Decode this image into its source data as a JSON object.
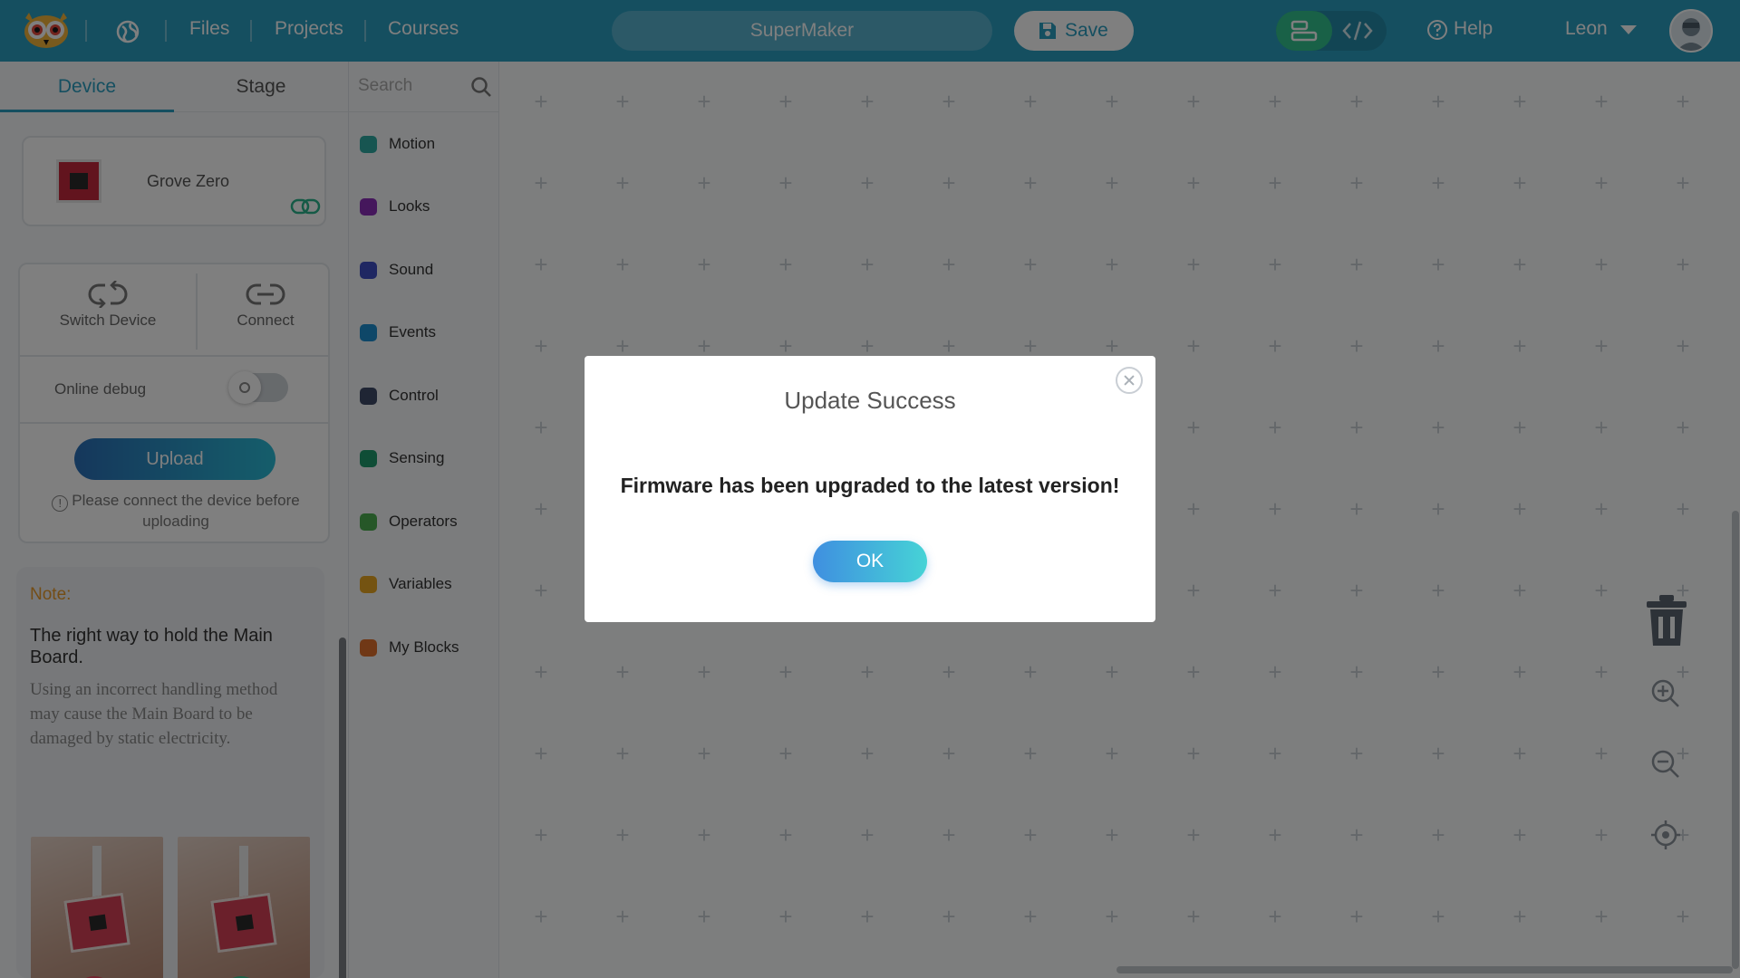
{
  "colors": {
    "topbar": "#2a9ec1",
    "accent": "#2a9ec1",
    "note_title": "#e89a2a",
    "ok_start": "#3f8fe0",
    "ok_end": "#46d3d6"
  },
  "topbar": {
    "logo_icon": "owl-logo-icon",
    "language_icon": "globe-icon",
    "menu": [
      "Files",
      "Projects",
      "Courses"
    ],
    "project_name": "SuperMaker",
    "save_label": "Save",
    "help_label": "Help",
    "user_name": "Leon"
  },
  "left_panel": {
    "tabs": [
      "Device",
      "Stage"
    ],
    "active_tab": "Device",
    "device_name": "Grove Zero",
    "switch_device_label": "Switch Device",
    "connect_label": "Connect",
    "online_debug_label": "Online debug",
    "online_debug_on": false,
    "upload_label": "Upload",
    "upload_hint": "Please connect the device before uploading",
    "note": {
      "title": "Note:",
      "heading": "The right way to hold the Main Board.",
      "body": "Using an incorrect handling method may cause the Main Board to be damaged by static electricity."
    }
  },
  "palette": {
    "search_placeholder": "Search",
    "categories": [
      {
        "label": "Motion",
        "color": "#2eaaa3"
      },
      {
        "label": "Looks",
        "color": "#8a2eb8"
      },
      {
        "label": "Sound",
        "color": "#3f4fc4"
      },
      {
        "label": "Events",
        "color": "#1d8fd0"
      },
      {
        "label": "Control",
        "color": "#3e4a68"
      },
      {
        "label": "Sensing",
        "color": "#1e9a6c"
      },
      {
        "label": "Operators",
        "color": "#4caf50"
      },
      {
        "label": "Variables",
        "color": "#e8a622"
      },
      {
        "label": "My Blocks",
        "color": "#e0702c"
      }
    ]
  },
  "modal": {
    "title": "Update Success",
    "message": "Firmware has been upgraded to the latest version!",
    "ok_label": "OK"
  }
}
